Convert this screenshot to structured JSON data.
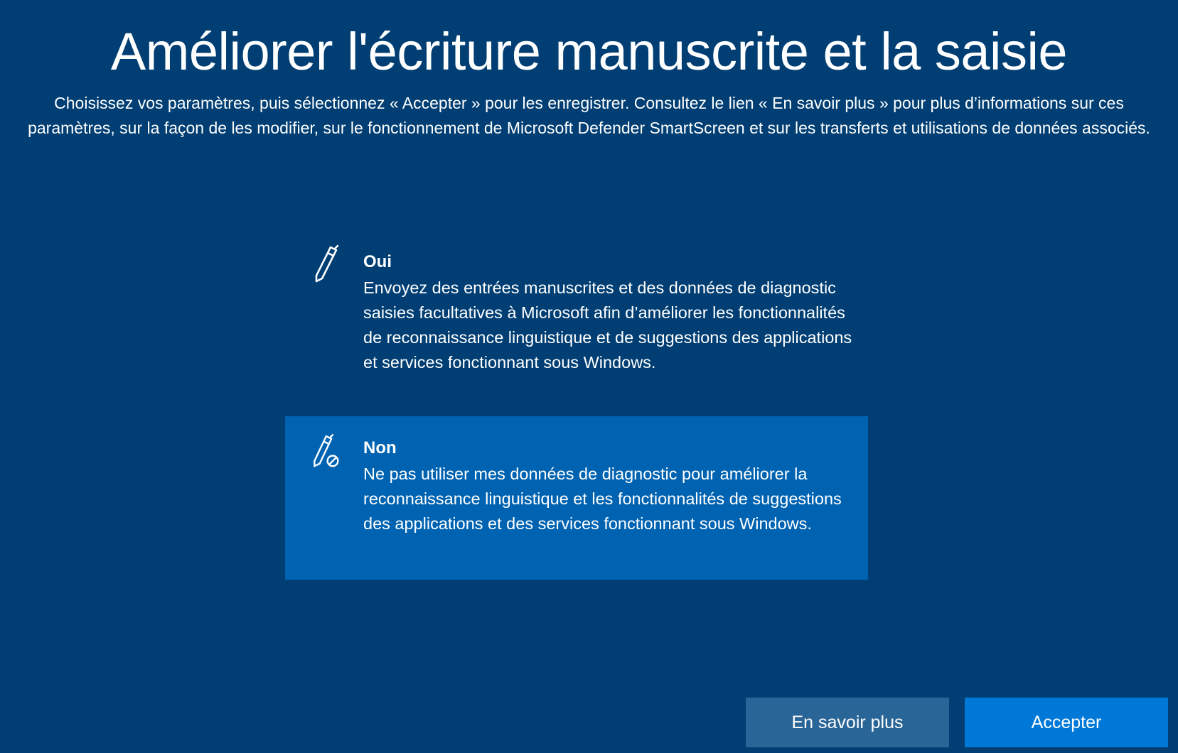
{
  "page": {
    "title": "Améliorer l'écriture manuscrite et la saisie",
    "subtitle": "Choisissez vos paramètres, puis sélectionnez « Accepter » pour les enregistrer. Consultez le lien « En savoir plus » pour plus d’informations sur ces paramètres, sur la façon de les modifier, sur le fonctionnement de Microsoft Defender SmartScreen et sur les transferts et utilisations de données associés."
  },
  "options": [
    {
      "icon": "pen-icon",
      "label": "Oui",
      "description": "Envoyez des entrées manuscrites et des données de diagnostic saisies facultatives à Microsoft afin d’améliorer les fonctionnalités de reconnaissance linguistique et de suggestions des applications et services fonctionnant sous Windows.",
      "selected": false
    },
    {
      "icon": "pen-blocked-icon",
      "label": "Non",
      "description": "Ne pas utiliser mes données de diagnostic pour améliorer la reconnaissance linguistique et les fonctionnalités de suggestions des applications et des services fonctionnant sous Windows.",
      "selected": true
    }
  ],
  "buttons": {
    "learn_more": "En savoir plus",
    "accept": "Accepter"
  },
  "colors": {
    "background": "#003e73",
    "selected_option": "#0063b1",
    "secondary_button": "#2a6597",
    "primary_button": "#0078d7",
    "text": "#ffffff"
  }
}
